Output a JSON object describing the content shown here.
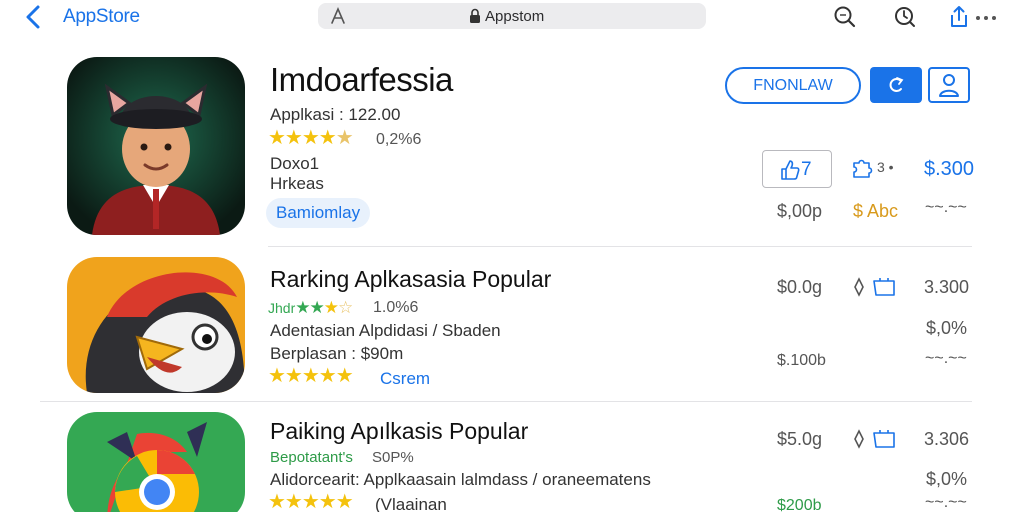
{
  "topbar": {
    "title": "AppStore",
    "url": "Appstom",
    "accent": "#1a73e8"
  },
  "featured": {
    "title": "Imdoarfessia",
    "meta": "Applkasi : 122.00",
    "rating_text": "0,2%6",
    "line1": "Doxo1",
    "line2": "Hrkeas",
    "tag": "Bamiomlay",
    "btn_primary": "FNONLAW",
    "share_label": "7",
    "count_label": "3 •",
    "price": "$.300",
    "price2": "$,00p",
    "price3": "$ Abc",
    "dots": "~~.~~",
    "stars": 4.5
  },
  "rows": [
    {
      "title": "Rarking Aplkasasia Popular",
      "stars_label": "Jhdr",
      "rating_text": "1.0%6",
      "desc": "Adentasian   Alpdidasi / Sbaden",
      "sub": "Berplasan : $90m",
      "stars2_label": "Csrem",
      "price_a": "$0.0g",
      "price_b": "3.300",
      "price_c": "$,0%",
      "price_d": "$.100b",
      "dots": "~~.~~",
      "stars": 3.5
    },
    {
      "title": "Paiking Apılkasis Popular",
      "stars_label": "Bepotatant's",
      "rating_text": "S0P%",
      "desc": "Alidorcearit: Applkaasain lalmdass / oraneematens",
      "sub": "(Vlaainan",
      "price_a": "$5.0g",
      "price_b": "3.306",
      "price_c": "$,0%",
      "price_d": "$200b",
      "dots": "~~.~~",
      "stars": 5
    }
  ]
}
